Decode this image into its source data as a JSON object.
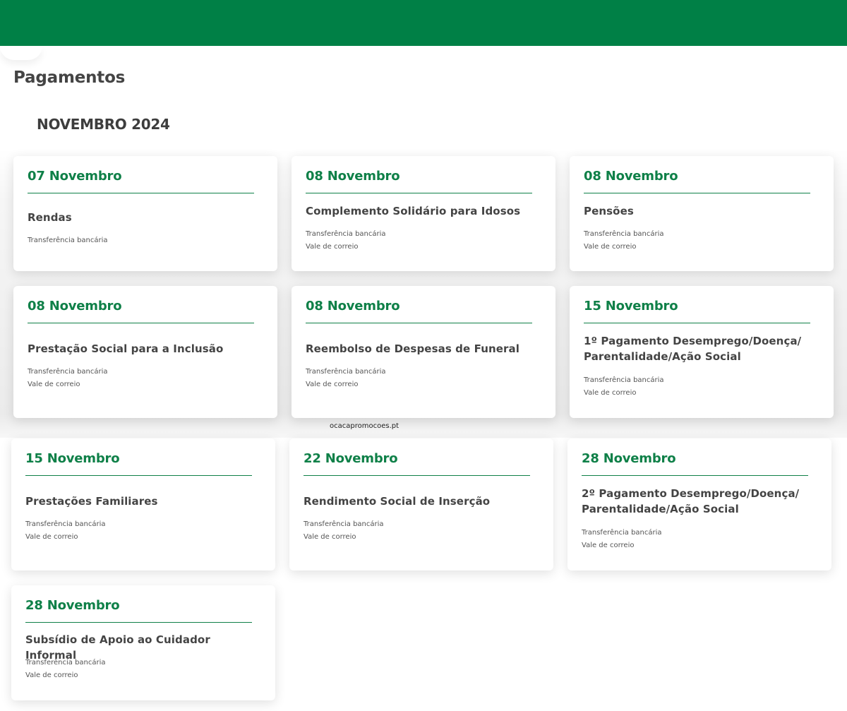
{
  "header": {
    "brand_color": "#008046"
  },
  "page": {
    "title": "Pagamentos",
    "month": "NOVEMBRO 2024"
  },
  "watermark": "ocacapromocoes.pt",
  "cards": [
    {
      "date": "07 Novembro",
      "benefit": "Rendas",
      "methods": [
        "Transferência bancária"
      ]
    },
    {
      "date": "08 Novembro",
      "benefit": "Complemento Solidário para Idosos",
      "methods": [
        "Transferência bancária",
        "Vale de correio"
      ]
    },
    {
      "date": "08 Novembro",
      "benefit": "Pensões",
      "methods": [
        "Transferência bancária",
        "Vale de correio"
      ]
    },
    {
      "date": "08 Novembro",
      "benefit": "Prestação Social para a Inclusão",
      "methods": [
        "Transferência bancária",
        "Vale de correio"
      ]
    },
    {
      "date": "08 Novembro",
      "benefit": "Reembolso de Despesas de Funeral",
      "methods": [
        "Transferência bancária",
        "Vale de correio"
      ]
    },
    {
      "date": "15 Novembro",
      "benefit": "1º Pagamento Desemprego/Doença/ Parentalidade/Ação Social",
      "methods": [
        "Transferência bancária",
        "Vale de correio"
      ]
    },
    {
      "date": "15 Novembro",
      "benefit": "Prestações Familiares",
      "methods": [
        "Transferência bancária",
        "Vale de correio"
      ]
    },
    {
      "date": "22 Novembro",
      "benefit": "Rendimento Social de Inserção",
      "methods": [
        "Transferência bancária",
        "Vale de correio"
      ]
    },
    {
      "date": "28 Novembro",
      "benefit": "2º Pagamento Desemprego/Doença/ Parentalidade/Ação Social",
      "methods": [
        "Transferência bancária",
        "Vale de correio"
      ]
    },
    {
      "date": "28 Novembro",
      "benefit": "Subsídio de Apoio ao Cuidador Informal",
      "methods": [
        "Transferência bancária",
        "Vale de correio"
      ]
    }
  ]
}
